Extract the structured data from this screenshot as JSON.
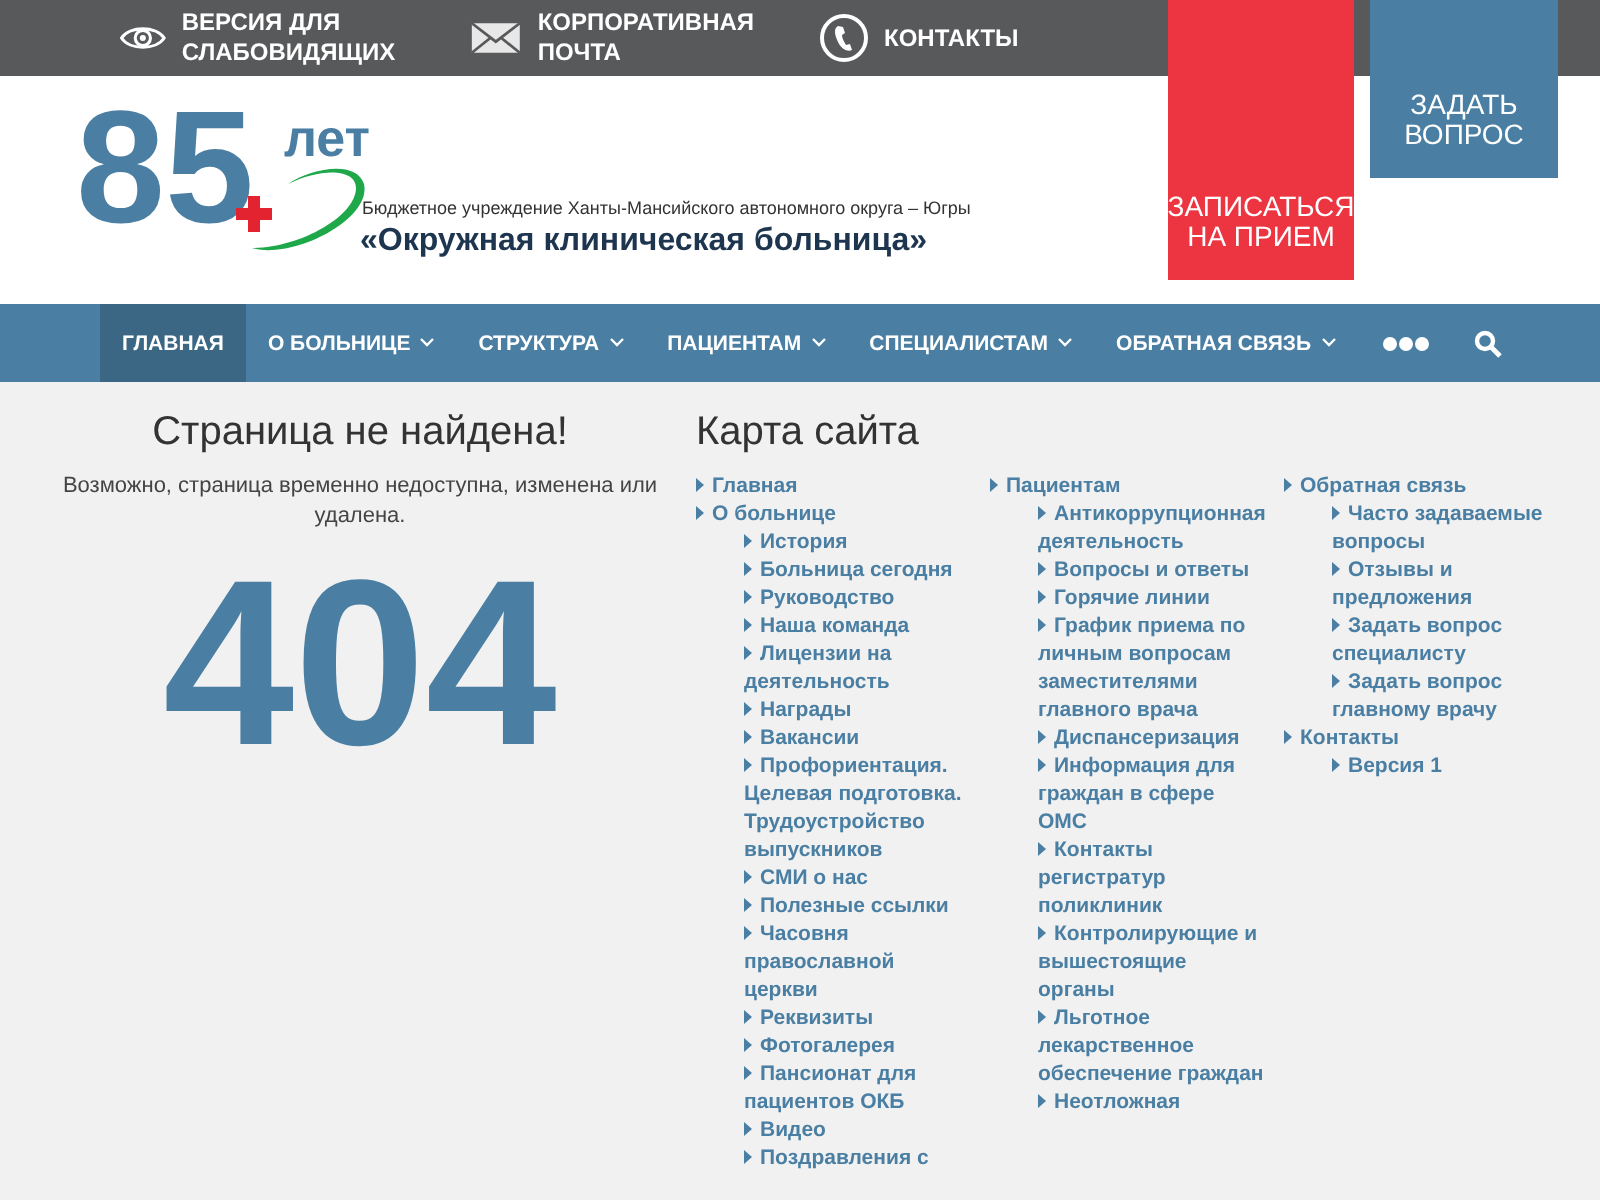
{
  "top_bar": {
    "links": [
      {
        "kind": "eye",
        "label": "ВЕРСИЯ ДЛЯ СЛАБОВИДЯЩИХ"
      },
      {
        "kind": "mail",
        "label": "КОРПОРАТИВНАЯ ПОЧТА"
      },
      {
        "kind": "phone",
        "label": "КОНТАКТЫ"
      }
    ]
  },
  "header": {
    "logo": {
      "number": "85",
      "years": "лет",
      "subtitle": "Бюджетное учреждение Ханты-Мансийского автономного округа – Югры",
      "name": "«Окружная клиническая больница»"
    },
    "buttons": [
      {
        "kind": "primary",
        "label": "ЗАПИСАТЬСЯ НА ПРИЕМ"
      },
      {
        "kind": "secondary",
        "label": "ЗАДАТЬ ВОПРОС"
      }
    ]
  },
  "nav": {
    "items": [
      {
        "label": "ГЛАВНАЯ",
        "selected": true,
        "dropdown": false
      },
      {
        "label": "О БОЛЬНИЦЕ",
        "selected": false,
        "dropdown": true
      },
      {
        "label": "СТРУКТУРА",
        "selected": false,
        "dropdown": true
      },
      {
        "label": "ПАЦИЕНТАМ",
        "selected": false,
        "dropdown": true
      },
      {
        "label": "СПЕЦИАЛИСТАМ",
        "selected": false,
        "dropdown": true
      },
      {
        "label": "ОБРАТНАЯ СВЯЗЬ",
        "selected": false,
        "dropdown": true
      }
    ]
  },
  "not_found": {
    "title": "Страница не найдена!",
    "message": "Возможно, страница временно недоступна, изменена или удалена.",
    "code": "404"
  },
  "sitemap": {
    "title": "Карта сайта",
    "columns": [
      [
        {
          "label": "Главная"
        },
        {
          "label": "О больнице",
          "children": [
            {
              "label": "История"
            },
            {
              "label": "Больница сегодня"
            },
            {
              "label": "Руководство"
            },
            {
              "label": "Наша команда"
            },
            {
              "label": "Лицензии на деятельность"
            },
            {
              "label": "Награды"
            },
            {
              "label": "Вакансии"
            },
            {
              "label": "Профориентация. Целевая подготовка. Трудоустройство выпускников"
            },
            {
              "label": "СМИ о нас"
            },
            {
              "label": "Полезные ссылки"
            },
            {
              "label": "Часовня православной церкви"
            },
            {
              "label": "Реквизиты"
            },
            {
              "label": "Фотогалерея"
            },
            {
              "label": "Пансионат для пациентов ОКБ"
            },
            {
              "label": "Видео"
            },
            {
              "label": "Поздравления с"
            }
          ]
        }
      ],
      [
        {
          "label": "Пациентам",
          "children": [
            {
              "label": "Антикоррупционная деятельность"
            },
            {
              "label": "Вопросы и ответы"
            },
            {
              "label": "Горячие линии"
            },
            {
              "label": "График приема по личным вопросам заместителями главного врача"
            },
            {
              "label": "Диспансеризация"
            },
            {
              "label": "Информация для граждан в сфере ОМС"
            },
            {
              "label": "Контакты регистратур поликлиник"
            },
            {
              "label": "Контролирующие и вышестоящие органы"
            },
            {
              "label": "Льготное лекарственное обеспечение граждан"
            },
            {
              "label": "Неотложная"
            }
          ]
        }
      ],
      [
        {
          "label": "Обратная связь",
          "children": [
            {
              "label": "Часто задаваемые вопросы"
            },
            {
              "label": "Отзывы и предложения"
            },
            {
              "label": "Задать вопрос специалисту"
            },
            {
              "label": "Задать вопрос главному врачу"
            }
          ]
        },
        {
          "label": "Контакты",
          "children": [
            {
              "label": "Версия 1"
            }
          ]
        }
      ]
    ]
  }
}
